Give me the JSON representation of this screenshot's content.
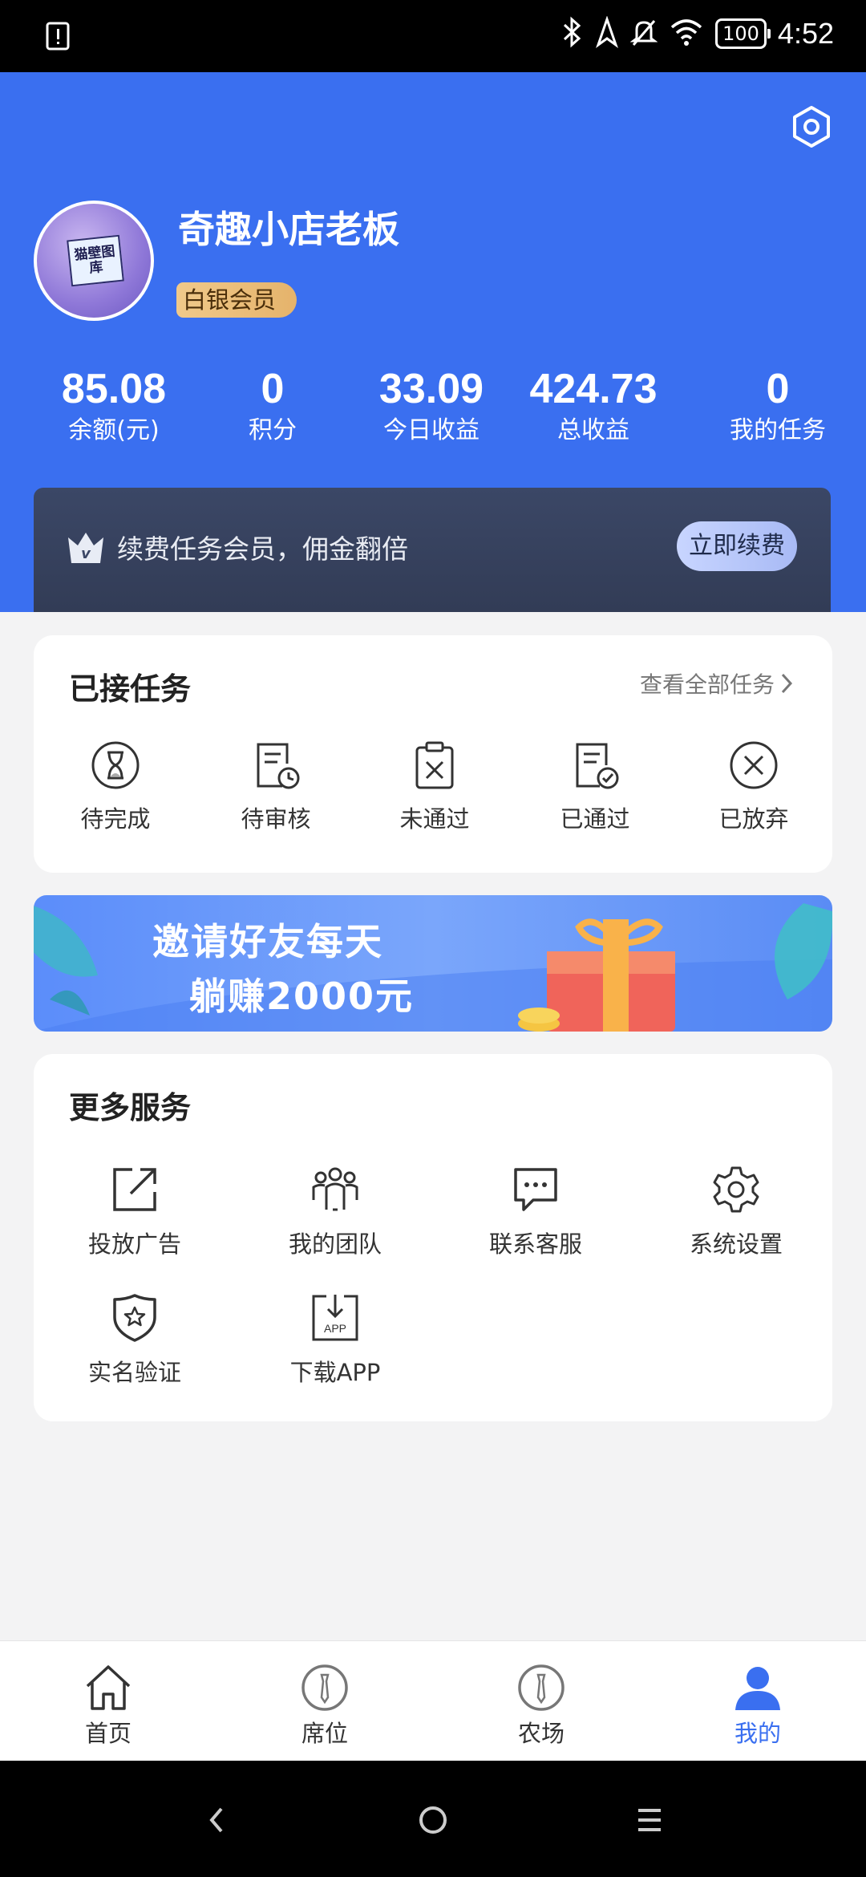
{
  "status_bar": {
    "time": "4:52",
    "battery": "100"
  },
  "profile": {
    "name": "奇趣小店老板",
    "badge": "白银会员",
    "avatar_text": "猫壁图库"
  },
  "stats": [
    {
      "value": "85.08",
      "label": "余额(元)"
    },
    {
      "value": "0",
      "label": "积分"
    },
    {
      "value": "33.09",
      "label": "今日收益"
    },
    {
      "value": "424.73",
      "label": "总收益"
    },
    {
      "value": "0",
      "label": "我的任务"
    }
  ],
  "promo": {
    "text": "续费任务会员，佣金翻倍",
    "button": "立即续费"
  },
  "tasks": {
    "title": "已接任务",
    "view_all": "查看全部任务",
    "items": [
      {
        "label": "待完成",
        "icon": "hourglass-icon"
      },
      {
        "label": "待审核",
        "icon": "document-clock-icon"
      },
      {
        "label": "未通过",
        "icon": "clipboard-x-icon"
      },
      {
        "label": "已通过",
        "icon": "document-check-icon"
      },
      {
        "label": "已放弃",
        "icon": "circle-x-icon"
      }
    ]
  },
  "banner": {
    "line1": "邀请好友每天",
    "line2": "躺赚2000元"
  },
  "services": {
    "title": "更多服务",
    "items": [
      {
        "label": "投放广告",
        "icon": "external-link-icon"
      },
      {
        "label": "我的团队",
        "icon": "team-icon"
      },
      {
        "label": "联系客服",
        "icon": "chat-bubble-icon"
      },
      {
        "label": "系统设置",
        "icon": "gear-icon"
      },
      {
        "label": "实名验证",
        "icon": "shield-star-icon"
      },
      {
        "label": "下载APP",
        "icon": "download-app-icon",
        "icon_text": "APP"
      }
    ]
  },
  "tabbar": {
    "items": [
      {
        "label": "首页",
        "icon": "home-icon"
      },
      {
        "label": "席位",
        "icon": "seat-icon"
      },
      {
        "label": "农场",
        "icon": "farm-icon"
      },
      {
        "label": "我的",
        "icon": "user-icon",
        "active": true
      }
    ],
    "active_color": "#3a6ff0"
  },
  "colors": {
    "primary": "#3a6ff0",
    "badge_gold": "#e5b36b"
  }
}
